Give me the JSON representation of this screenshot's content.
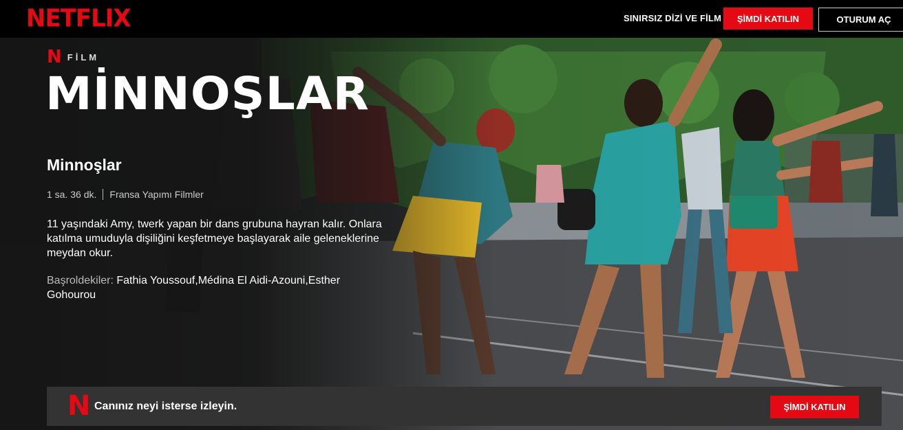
{
  "header": {
    "logo_text": "NETFLIX",
    "tagline": "SINIRSIZ DİZİ VE FİLM",
    "join_label": "ŞİMDİ KATILIN",
    "signin_label": "OTURUM AÇ"
  },
  "hero": {
    "badge_type": "FİLM",
    "title_logo": "MİNNOŞLAR",
    "title": "Minnoşlar",
    "duration": "1 sa. 36 dk.",
    "genre": "Fransa Yapımı Filmler",
    "synopsis": "11 yaşındaki Amy, twerk yapan bir dans grubuna hayran kalır. Onlara katılma umuduyla dişiliğini keşfetmeye başlayarak aile geleneklerine meydan okur.",
    "cast_label": "Başroldekiler:",
    "cast_names": "Fathia Youssouf,Médina El Aidi-Azouni,Esther Gohourou"
  },
  "banner": {
    "message": "Canınız neyi isterse izleyin.",
    "join_label": "ŞİMDİ KATILIN"
  },
  "colors": {
    "brand_red": "#e50914",
    "background": "#141414",
    "banner_bg": "#333333"
  },
  "icons": {
    "brand": "netflix-n-icon"
  }
}
